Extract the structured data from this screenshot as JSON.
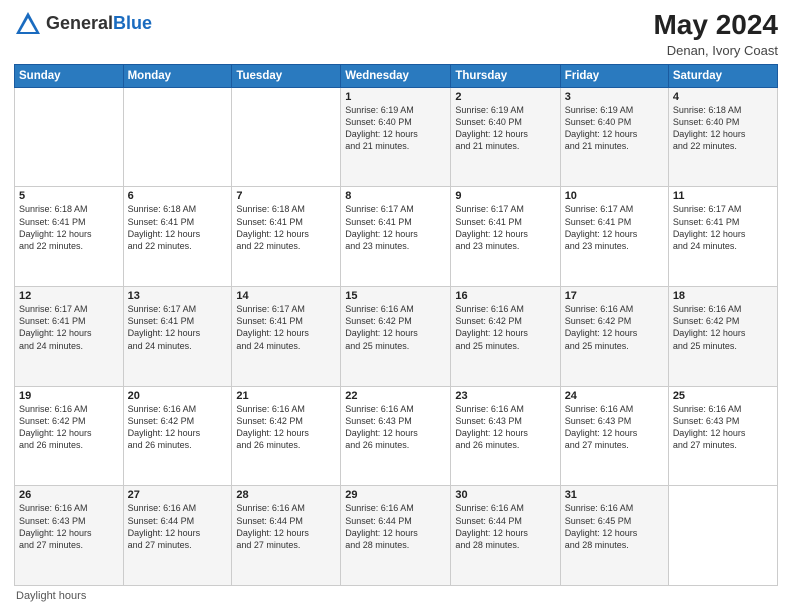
{
  "header": {
    "logo_general": "General",
    "logo_blue": "Blue",
    "month_year": "May 2024",
    "location": "Denan, Ivory Coast"
  },
  "footer": {
    "note": "Daylight hours"
  },
  "weekdays": [
    "Sunday",
    "Monday",
    "Tuesday",
    "Wednesday",
    "Thursday",
    "Friday",
    "Saturday"
  ],
  "weeks": [
    [
      {
        "day": "",
        "info": ""
      },
      {
        "day": "",
        "info": ""
      },
      {
        "day": "",
        "info": ""
      },
      {
        "day": "1",
        "info": "Sunrise: 6:19 AM\nSunset: 6:40 PM\nDaylight: 12 hours\nand 21 minutes."
      },
      {
        "day": "2",
        "info": "Sunrise: 6:19 AM\nSunset: 6:40 PM\nDaylight: 12 hours\nand 21 minutes."
      },
      {
        "day": "3",
        "info": "Sunrise: 6:19 AM\nSunset: 6:40 PM\nDaylight: 12 hours\nand 21 minutes."
      },
      {
        "day": "4",
        "info": "Sunrise: 6:18 AM\nSunset: 6:40 PM\nDaylight: 12 hours\nand 22 minutes."
      }
    ],
    [
      {
        "day": "5",
        "info": "Sunrise: 6:18 AM\nSunset: 6:41 PM\nDaylight: 12 hours\nand 22 minutes."
      },
      {
        "day": "6",
        "info": "Sunrise: 6:18 AM\nSunset: 6:41 PM\nDaylight: 12 hours\nand 22 minutes."
      },
      {
        "day": "7",
        "info": "Sunrise: 6:18 AM\nSunset: 6:41 PM\nDaylight: 12 hours\nand 22 minutes."
      },
      {
        "day": "8",
        "info": "Sunrise: 6:17 AM\nSunset: 6:41 PM\nDaylight: 12 hours\nand 23 minutes."
      },
      {
        "day": "9",
        "info": "Sunrise: 6:17 AM\nSunset: 6:41 PM\nDaylight: 12 hours\nand 23 minutes."
      },
      {
        "day": "10",
        "info": "Sunrise: 6:17 AM\nSunset: 6:41 PM\nDaylight: 12 hours\nand 23 minutes."
      },
      {
        "day": "11",
        "info": "Sunrise: 6:17 AM\nSunset: 6:41 PM\nDaylight: 12 hours\nand 24 minutes."
      }
    ],
    [
      {
        "day": "12",
        "info": "Sunrise: 6:17 AM\nSunset: 6:41 PM\nDaylight: 12 hours\nand 24 minutes."
      },
      {
        "day": "13",
        "info": "Sunrise: 6:17 AM\nSunset: 6:41 PM\nDaylight: 12 hours\nand 24 minutes."
      },
      {
        "day": "14",
        "info": "Sunrise: 6:17 AM\nSunset: 6:41 PM\nDaylight: 12 hours\nand 24 minutes."
      },
      {
        "day": "15",
        "info": "Sunrise: 6:16 AM\nSunset: 6:42 PM\nDaylight: 12 hours\nand 25 minutes."
      },
      {
        "day": "16",
        "info": "Sunrise: 6:16 AM\nSunset: 6:42 PM\nDaylight: 12 hours\nand 25 minutes."
      },
      {
        "day": "17",
        "info": "Sunrise: 6:16 AM\nSunset: 6:42 PM\nDaylight: 12 hours\nand 25 minutes."
      },
      {
        "day": "18",
        "info": "Sunrise: 6:16 AM\nSunset: 6:42 PM\nDaylight: 12 hours\nand 25 minutes."
      }
    ],
    [
      {
        "day": "19",
        "info": "Sunrise: 6:16 AM\nSunset: 6:42 PM\nDaylight: 12 hours\nand 26 minutes."
      },
      {
        "day": "20",
        "info": "Sunrise: 6:16 AM\nSunset: 6:42 PM\nDaylight: 12 hours\nand 26 minutes."
      },
      {
        "day": "21",
        "info": "Sunrise: 6:16 AM\nSunset: 6:42 PM\nDaylight: 12 hours\nand 26 minutes."
      },
      {
        "day": "22",
        "info": "Sunrise: 6:16 AM\nSunset: 6:43 PM\nDaylight: 12 hours\nand 26 minutes."
      },
      {
        "day": "23",
        "info": "Sunrise: 6:16 AM\nSunset: 6:43 PM\nDaylight: 12 hours\nand 26 minutes."
      },
      {
        "day": "24",
        "info": "Sunrise: 6:16 AM\nSunset: 6:43 PM\nDaylight: 12 hours\nand 27 minutes."
      },
      {
        "day": "25",
        "info": "Sunrise: 6:16 AM\nSunset: 6:43 PM\nDaylight: 12 hours\nand 27 minutes."
      }
    ],
    [
      {
        "day": "26",
        "info": "Sunrise: 6:16 AM\nSunset: 6:43 PM\nDaylight: 12 hours\nand 27 minutes."
      },
      {
        "day": "27",
        "info": "Sunrise: 6:16 AM\nSunset: 6:44 PM\nDaylight: 12 hours\nand 27 minutes."
      },
      {
        "day": "28",
        "info": "Sunrise: 6:16 AM\nSunset: 6:44 PM\nDaylight: 12 hours\nand 27 minutes."
      },
      {
        "day": "29",
        "info": "Sunrise: 6:16 AM\nSunset: 6:44 PM\nDaylight: 12 hours\nand 28 minutes."
      },
      {
        "day": "30",
        "info": "Sunrise: 6:16 AM\nSunset: 6:44 PM\nDaylight: 12 hours\nand 28 minutes."
      },
      {
        "day": "31",
        "info": "Sunrise: 6:16 AM\nSunset: 6:45 PM\nDaylight: 12 hours\nand 28 minutes."
      },
      {
        "day": "",
        "info": ""
      }
    ]
  ]
}
